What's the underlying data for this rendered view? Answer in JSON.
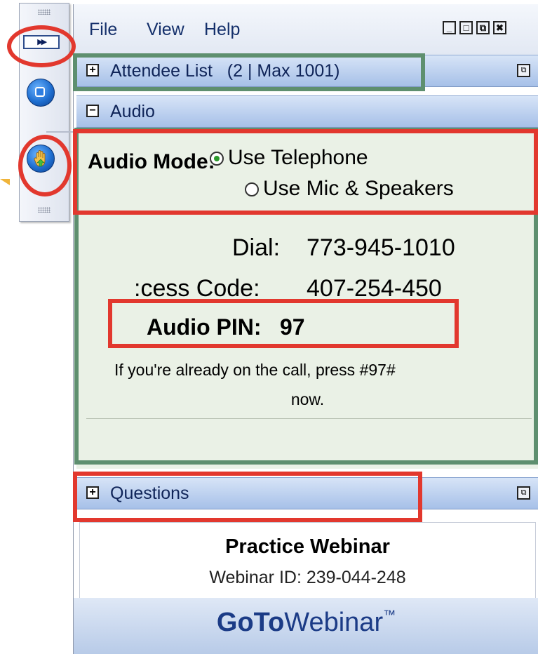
{
  "menu": {
    "file": "File",
    "view": "View",
    "help": "Help"
  },
  "window_controls": {
    "minimize": "_",
    "restore": "□",
    "popout": "⧉",
    "close": "✖"
  },
  "left_strip": {
    "expand_glyph": "▸▸"
  },
  "sections": {
    "attendee": {
      "toggle": "+",
      "label": "Attendee List",
      "count": "(2 | Max 1001)"
    },
    "audio": {
      "toggle": "−",
      "label": "Audio"
    },
    "questions": {
      "toggle": "+",
      "label": "Questions"
    }
  },
  "audio": {
    "mode_label": "Audio Mode:",
    "options": [
      {
        "label": "Use Telephone",
        "selected": true
      },
      {
        "label": "Use Mic & Speakers",
        "selected": false
      }
    ],
    "dial_label": "Dial:",
    "dial_value": "773-945-1010",
    "access_label": ":cess Code:",
    "access_value": "407-254-450",
    "pin_label": "Audio PIN:",
    "pin_value": "97",
    "note_line1": "If you're already on the call, press #97#",
    "note_line2": "now."
  },
  "webinar": {
    "title": "Practice Webinar",
    "id_text": "Webinar ID: 239-044-248"
  },
  "brand": {
    "go": "Go",
    "to": "To",
    "rest": "Webinar",
    "tm": "™"
  },
  "colors": {
    "annotation_red": "#e2382e",
    "annotation_green": "#5e8f6f",
    "header_blue": "#a6c0e8"
  }
}
